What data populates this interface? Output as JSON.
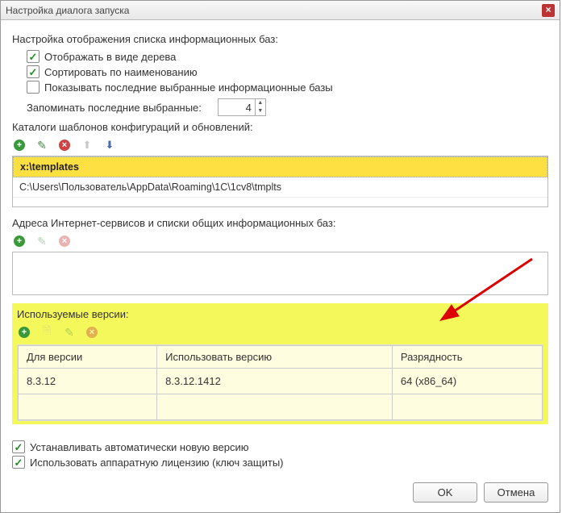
{
  "window": {
    "title": "Настройка диалога запуска"
  },
  "list_display": {
    "heading": "Настройка отображения списка информационных баз:",
    "tree": {
      "label": "Отображать в виде дерева",
      "checked": true
    },
    "sort": {
      "label": "Сортировать по наименованию",
      "checked": true
    },
    "recent": {
      "label": "Показывать последние выбранные информационные базы",
      "checked": false
    },
    "remember": {
      "label": "Запоминать последние выбранные:",
      "value": "4"
    }
  },
  "templates": {
    "heading": "Каталоги шаблонов конфигураций и обновлений:",
    "rows": [
      {
        "path": "x:\\templates",
        "selected": true
      },
      {
        "path": "C:\\Users\\Пользователь\\AppData\\Roaming\\1C\\1cv8\\tmplts",
        "selected": false
      }
    ]
  },
  "services": {
    "heading": "Адреса Интернет-сервисов и списки общих информационных баз:"
  },
  "versions": {
    "heading": "Используемые версии:",
    "columns": {
      "for": "Для версии",
      "use": "Использовать версию",
      "arch": "Разрядность"
    },
    "rows": [
      {
        "for": "8.3.12",
        "use": "8.3.12.1412",
        "arch": "64 (x86_64)"
      }
    ]
  },
  "bottom": {
    "auto_update": {
      "label": "Устанавливать автоматически новую версию",
      "checked": true
    },
    "hw_license": {
      "label": "Использовать аппаратную лицензию (ключ защиты)",
      "checked": true
    }
  },
  "buttons": {
    "ok": "OK",
    "cancel": "Отмена"
  }
}
